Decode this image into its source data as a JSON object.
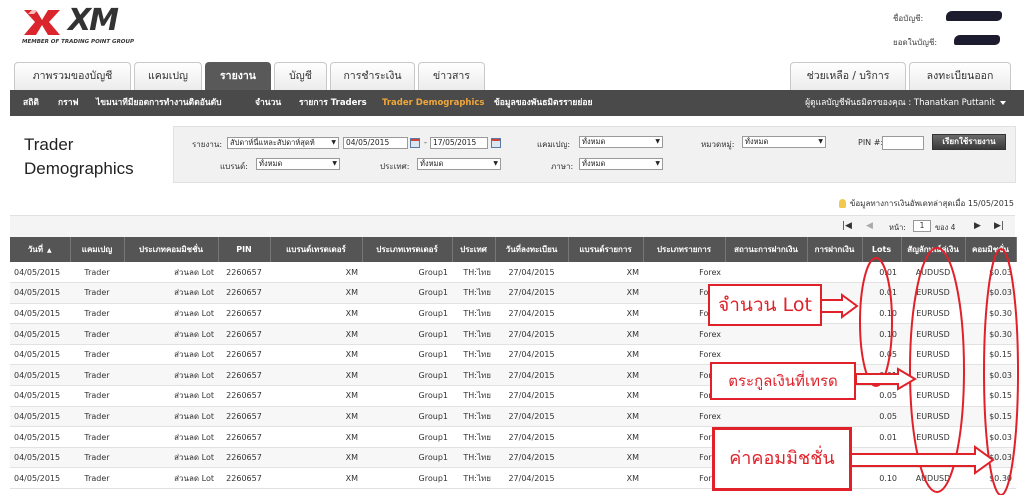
{
  "brand": {
    "logo_text": "XM",
    "tagline": "MEMBER OF TRADING POINT GROUP",
    "logo_color": "#d9252b"
  },
  "account": {
    "name_label": "ชื่อบัญชี:",
    "balance_label": "ยอดในบัญชี:"
  },
  "tabs_left": [
    "ภาพรวมของบัญชี",
    "แคมเปญ",
    "รายงาน",
    "บัญชี",
    "การชำระเงิน",
    "ข่าวสาร"
  ],
  "active_tab": "รายงาน",
  "tabs_right": [
    "ช่วยเหลือ / บริการ",
    "ลงทะเบียนออก"
  ],
  "subnav": {
    "items": [
      "สถิติ",
      "กราฟ",
      "ไขมนาทีมียอดการทำงานติดอันดับ",
      "จำนวน",
      "รายการ Traders",
      "Trader Demographics",
      "ข้อมูลของพันธมิตรรายย่อย"
    ],
    "active": "Trader Demographics",
    "manager": "ผู้ดูแลบัญชีพันธมิตรของคุณ : Thanatkan Puttanit"
  },
  "page_title_line1": "Trader",
  "page_title_line2": "Demographics",
  "filters": {
    "report_label": "รายงาน:",
    "report_value": "สัปดาห์นี้แหละสัปดาห์สุดท้",
    "date_from": "04/05/2015",
    "date_sep": "-",
    "date_to": "17/05/2015",
    "campaign_label": "แคมเปญ:",
    "campaign_value": "ทั้งหมด",
    "category_label": "หมวดหมู่:",
    "category_value": "ทั้งหมด",
    "pin_label": "PIN #:",
    "pin_value": "",
    "submit_label": "เรียกใช้รายงาน",
    "brand_label": "แบรนด์:",
    "brand_value": "ทั้งหมด",
    "country_label": "ประเทศ:",
    "country_value": "ทั้งหมด",
    "language_label": "ภาษา:",
    "language_value": "ทั้งหมด"
  },
  "info_text": "ข้อมูลทางการเงินอัพเดทล่าสุดเมื่อ 15/05/2015",
  "pager": {
    "page_label": "หน้า:",
    "page_value": "1",
    "of_text": "ของ 4"
  },
  "table": {
    "columns": [
      "วันที่",
      "แคมเปญ",
      "ประเภทคอมมิชชั่น",
      "PIN",
      "แบรนด์เทรดเดอร์",
      "ประเภทเทรดเดอร์",
      "ประเทศ",
      "วันที่ลงทะเบียน",
      "แบรนด์รายการ",
      "ประเภทรายการ",
      "สถานะการฝากเงิน",
      "การฝากเงิน",
      "Lots",
      "สัญลักษณ์คู่เงิน",
      "คอมมิชชั่น"
    ],
    "rows": [
      [
        "04/05/2015",
        "Trader",
        "ส่วนลด Lot",
        "2260657",
        "XM",
        "Group1",
        "TH:ไทย",
        "27/04/2015",
        "XM",
        "Forex",
        "",
        "",
        "0.01",
        "AUDUSD",
        "$0.03"
      ],
      [
        "04/05/2015",
        "Trader",
        "ส่วนลด Lot",
        "2260657",
        "XM",
        "Group1",
        "TH:ไทย",
        "27/04/2015",
        "XM",
        "Forex",
        "",
        "",
        "0.01",
        "EURUSD",
        "$0.03"
      ],
      [
        "04/05/2015",
        "Trader",
        "ส่วนลด Lot",
        "2260657",
        "XM",
        "Group1",
        "TH:ไทย",
        "27/04/2015",
        "XM",
        "Forex",
        "",
        "",
        "0.10",
        "EURUSD",
        "$0.30"
      ],
      [
        "04/05/2015",
        "Trader",
        "ส่วนลด Lot",
        "2260657",
        "XM",
        "Group1",
        "TH:ไทย",
        "27/04/2015",
        "XM",
        "Forex",
        "",
        "",
        "0.10",
        "EURUSD",
        "$0.30"
      ],
      [
        "04/05/2015",
        "Trader",
        "ส่วนลด Lot",
        "2260657",
        "XM",
        "Group1",
        "TH:ไทย",
        "27/04/2015",
        "XM",
        "Forex",
        "",
        "",
        "0.05",
        "EURUSD",
        "$0.15"
      ],
      [
        "04/05/2015",
        "Trader",
        "ส่วนลด Lot",
        "2260657",
        "XM",
        "Group1",
        "TH:ไทย",
        "27/04/2015",
        "XM",
        "Forex",
        "",
        "",
        "0.01",
        "EURUSD",
        "$0.03"
      ],
      [
        "04/05/2015",
        "Trader",
        "ส่วนลด Lot",
        "2260657",
        "XM",
        "Group1",
        "TH:ไทย",
        "27/04/2015",
        "XM",
        "Forex",
        "",
        "",
        "0.05",
        "EURUSD",
        "$0.15"
      ],
      [
        "04/05/2015",
        "Trader",
        "ส่วนลด Lot",
        "2260657",
        "XM",
        "Group1",
        "TH:ไทย",
        "27/04/2015",
        "XM",
        "Forex",
        "",
        "",
        "0.05",
        "EURUSD",
        "$0.15"
      ],
      [
        "04/05/2015",
        "Trader",
        "ส่วนลด Lot",
        "2260657",
        "XM",
        "Group1",
        "TH:ไทย",
        "27/04/2015",
        "XM",
        "Forex",
        "",
        "",
        "0.01",
        "EURUSD",
        "$0.03"
      ],
      [
        "04/05/2015",
        "Trader",
        "ส่วนลด Lot",
        "2260657",
        "XM",
        "Group1",
        "TH:ไทย",
        "27/04/2015",
        "XM",
        "Forex",
        "",
        "",
        "0.01",
        "EURUSD",
        "$0.03"
      ],
      [
        "04/05/2015",
        "Trader",
        "ส่วนลด Lot",
        "2260657",
        "XM",
        "Group1",
        "TH:ไทย",
        "27/04/2015",
        "XM",
        "Forex",
        "",
        "",
        "0.10",
        "AUDUSD",
        "$0.30"
      ]
    ]
  },
  "annotations": {
    "lot": "จำนวน Lot",
    "pair": "ตระกูลเงินที่เทรด",
    "commission": "ค่าคอมมิชชั่น",
    "color": "#e0212a"
  }
}
